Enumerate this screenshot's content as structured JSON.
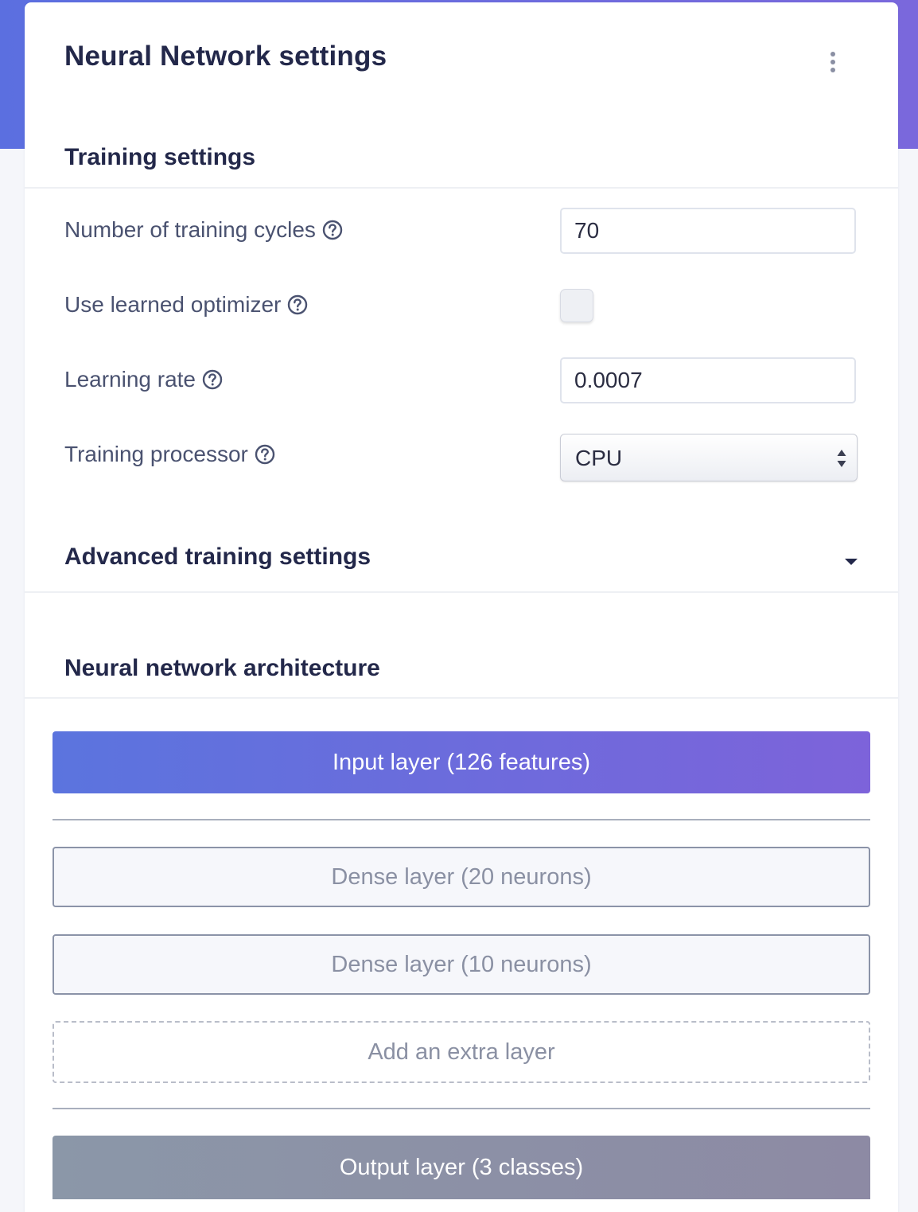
{
  "card": {
    "title": "Neural Network settings",
    "menu_icon": "kebab-vertical-icon"
  },
  "training": {
    "heading": "Training settings",
    "cycles": {
      "label": "Number of training cycles",
      "value": "70"
    },
    "optimizer": {
      "label": "Use learned optimizer",
      "checked": false
    },
    "learning_rate": {
      "label": "Learning rate",
      "value": "0.0007"
    },
    "processor": {
      "label": "Training processor",
      "selected": "CPU"
    },
    "help_icon": "question-circle-icon"
  },
  "advanced": {
    "heading": "Advanced training settings",
    "icon": "caret-down-icon"
  },
  "architecture": {
    "heading": "Neural network architecture",
    "input_layer": "Input layer (126 features)",
    "layers": [
      {
        "label": "Dense layer (20 neurons)"
      },
      {
        "label": "Dense layer (10 neurons)"
      }
    ],
    "add_layer": "Add an extra layer",
    "output_layer": "Output layer (3 classes)"
  },
  "colors": {
    "accent_start": "#5b74de",
    "accent_end": "#7d63da",
    "heading": "#23284a",
    "label": "#4a5270"
  }
}
